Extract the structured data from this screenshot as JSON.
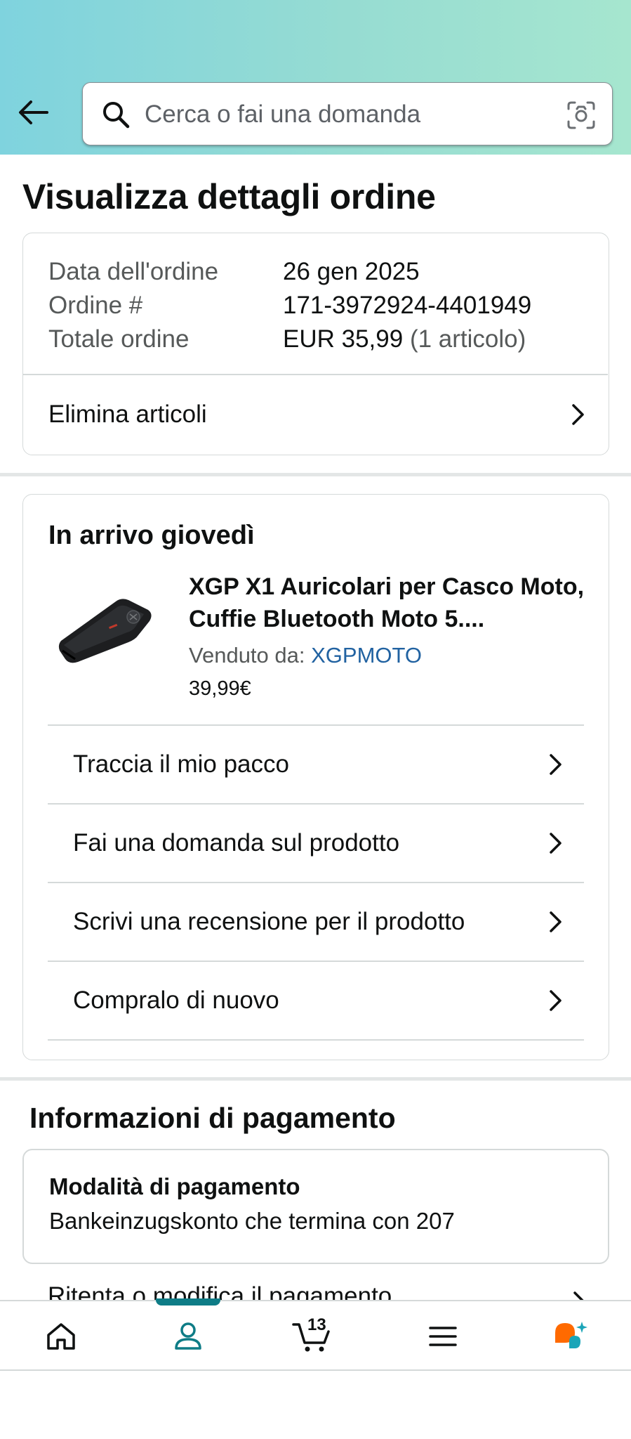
{
  "header": {
    "search_placeholder": "Cerca o fai una domanda"
  },
  "page_title": "Visualizza dettagli ordine",
  "order_summary": {
    "rows": [
      {
        "label": "Data dell'ordine",
        "value": "26 gen 2025"
      },
      {
        "label": "Ordine #",
        "value": "171-3972924-4401949"
      },
      {
        "label": "Totale ordine",
        "value": "EUR 35,99",
        "extra": "(1 articolo)"
      }
    ],
    "delete_items_label": "Elimina articoli"
  },
  "shipment": {
    "title": "In arrivo giovedì",
    "product": {
      "title": "XGP X1 Auricolari per Casco Moto, Cuffie Bluetooth Moto 5....",
      "sold_by_label": "Venduto da:",
      "seller": "XGPMOTO",
      "price": "39,99€"
    },
    "actions": [
      {
        "label": "Traccia il mio pacco"
      },
      {
        "label": "Fai una domanda sul prodotto"
      },
      {
        "label": "Scrivi una recensione per il prodotto"
      },
      {
        "label": "Compralo di nuovo"
      }
    ]
  },
  "payment": {
    "section_title": "Informazioni di pagamento",
    "method_label": "Modalità di pagamento",
    "method_value": "Bankeinzugskonto che termina con 207",
    "retry_label": "Ritenta o modifica il pagamento"
  },
  "bottom_nav": {
    "cart_count": "13",
    "active": "account"
  },
  "colors": {
    "accent": "#0e7c86",
    "link": "#2162a1",
    "rufus_orange": "#ff6a00",
    "rufus_teal": "#1aa5b8"
  }
}
